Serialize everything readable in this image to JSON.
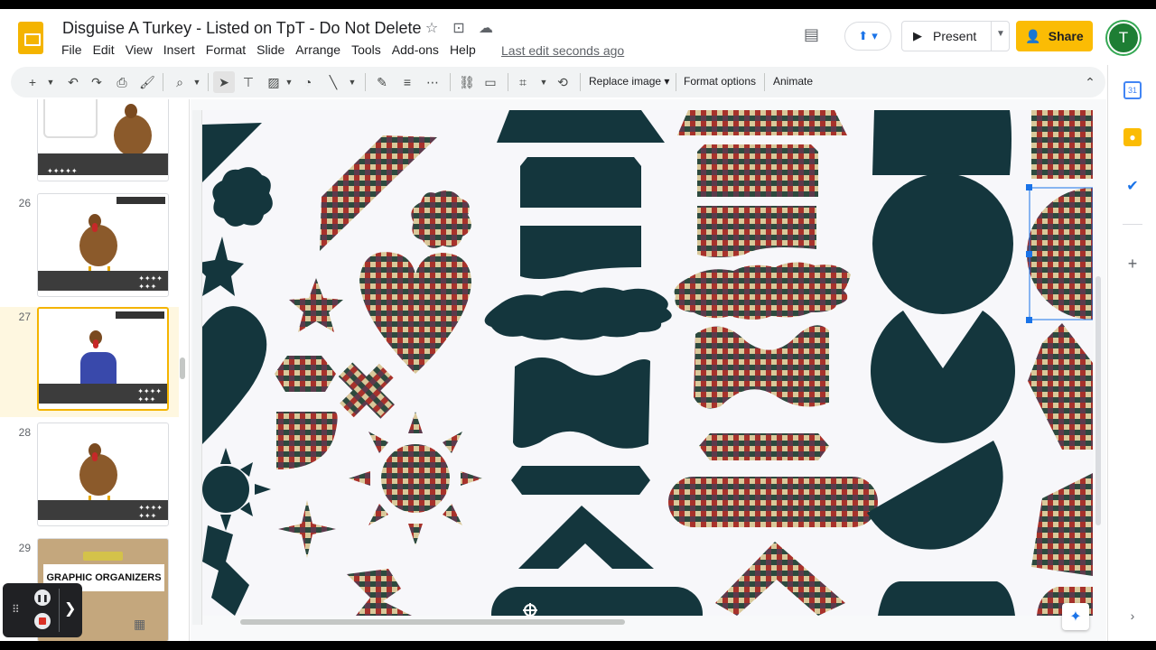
{
  "doc": {
    "title": "Disguise A Turkey - Listed on TpT - Do Not Delete",
    "last_edit": "Last edit seconds ago"
  },
  "menu": [
    "File",
    "Edit",
    "View",
    "Insert",
    "Format",
    "Slide",
    "Arrange",
    "Tools",
    "Add-ons",
    "Help"
  ],
  "header": {
    "present_label": "Present",
    "share_label": "Share",
    "avatar_initial": "T"
  },
  "toolbar": {
    "replace_image": "Replace image ▾",
    "format_options": "Format options",
    "animate": "Animate"
  },
  "slides": [
    {
      "number": "",
      "kind": "turkey-title"
    },
    {
      "number": "26",
      "kind": "turkey"
    },
    {
      "number": "27",
      "kind": "turkey-plaid",
      "selected": true
    },
    {
      "number": "28",
      "kind": "turkey"
    },
    {
      "number": "29",
      "kind": "graphic-organizers",
      "label": "GRAPHIC ORGANIZERS"
    }
  ],
  "colors": {
    "dark_teal": "#14363d",
    "accent_yellow": "#fbbc04",
    "selection_blue": "#1a73e8"
  }
}
